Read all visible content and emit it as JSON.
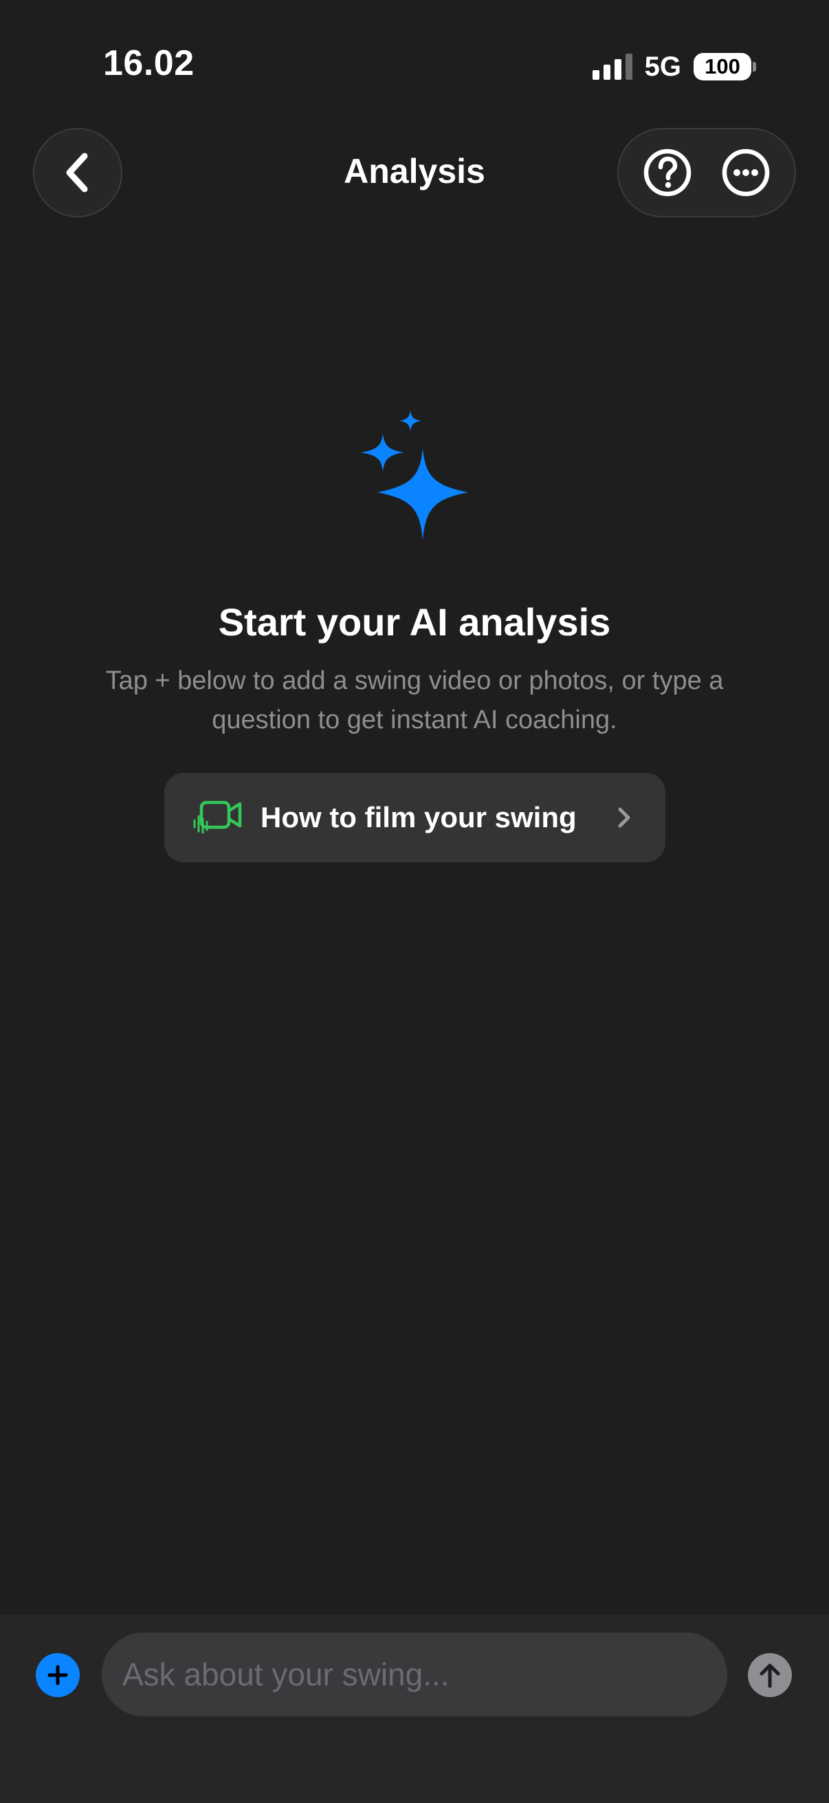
{
  "status_bar": {
    "time": "16.02",
    "network": "5G",
    "battery": "100"
  },
  "nav": {
    "title": "Analysis",
    "back_icon": "chevron-left-icon",
    "help_icon": "question-circle-icon",
    "more_icon": "ellipsis-circle-icon"
  },
  "empty_state": {
    "icon": "sparkles-icon",
    "title": "Start your AI analysis",
    "subtitle": "Tap + below to add a swing video or photos, or type a question to get instant AI coaching.",
    "film_button": {
      "label": "How to film your swing",
      "icon": "video-camera-icon",
      "chevron": "chevron-right-icon"
    }
  },
  "composer": {
    "placeholder": "Ask about your swing...",
    "value": "",
    "add_icon": "plus-icon",
    "send_icon": "arrow-up-icon"
  },
  "colors": {
    "background": "#1e1e1e",
    "accent_blue": "#0a84ff",
    "video_icon_green": "#34c759",
    "subtitle_gray": "#8e8e93"
  }
}
